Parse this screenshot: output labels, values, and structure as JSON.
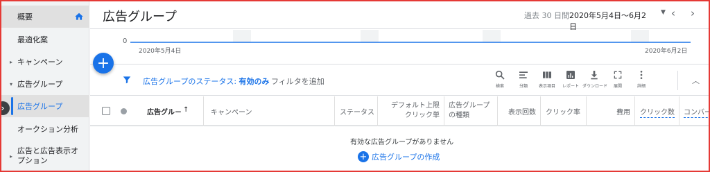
{
  "sidebar": {
    "items": [
      {
        "label": "概要"
      },
      {
        "label": "最適化案"
      },
      {
        "label": "キャンペーン"
      },
      {
        "label": "広告グループ"
      },
      {
        "label": "広告グループ"
      },
      {
        "label": "オークション分析"
      },
      {
        "label": "広告と広告表示オプション"
      }
    ],
    "collapse_glyph": "›"
  },
  "header": {
    "title": "広告グループ",
    "range_label": "過去 30 日間",
    "range_value": "2020年5月4日～6月2日"
  },
  "chart": {
    "zero_label": "0",
    "start_date": "2020年5月4日",
    "end_date": "2020年6月2日"
  },
  "fab": {
    "glyph": "+"
  },
  "toolbar": {
    "status_prefix": "広告グループのステータス: ",
    "status_value": "有効のみ",
    "add_filter": "フィルタを追加",
    "tools": [
      {
        "label": "検索",
        "icon": "search-icon"
      },
      {
        "label": "分類",
        "icon": "segment-icon"
      },
      {
        "label": "表示項目",
        "icon": "columns-icon"
      },
      {
        "label": "レポート",
        "icon": "reports-icon"
      },
      {
        "label": "ダウンロード",
        "icon": "download-icon"
      },
      {
        "label": "展開",
        "icon": "expand-icon"
      },
      {
        "label": "詳細",
        "icon": "more-icon"
      }
    ]
  },
  "table": {
    "columns": [
      {
        "label": "広告グル－",
        "sort": "↑"
      },
      {
        "label": "キャンペーン"
      },
      {
        "label": "ステータス"
      },
      {
        "label": "デフォルト上限クリック単"
      },
      {
        "label": "広告グループの種類"
      },
      {
        "label": "表示回数"
      },
      {
        "label": "クリック率"
      },
      {
        "label": "費用"
      },
      {
        "label": "クリック数"
      },
      {
        "label": "コンバー"
      }
    ]
  },
  "empty_state": {
    "message": "有効な広告グループがありません",
    "create_label": "広告グループの作成",
    "create_glyph": "+"
  },
  "colors": {
    "accent": "#1a73e8",
    "frame": "#e53935"
  }
}
